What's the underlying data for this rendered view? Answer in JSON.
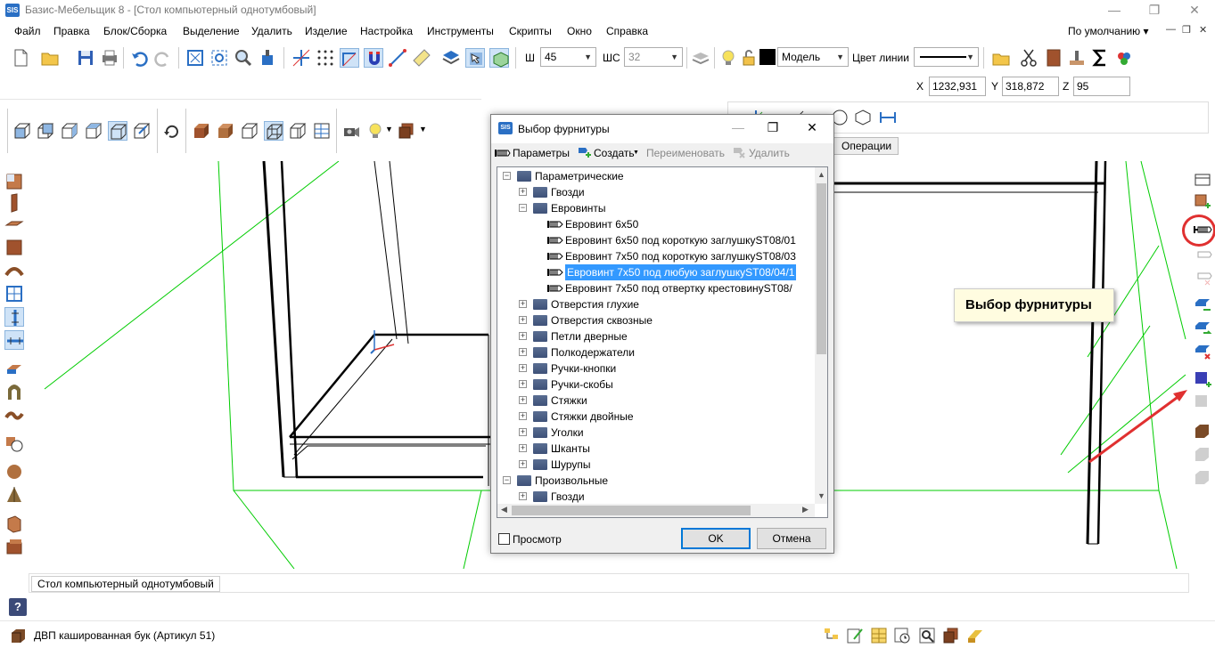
{
  "app": {
    "title": "Базис-Мебельщик 8 - [Стол компьютерный однотумбовый]",
    "icon_text": "SIS",
    "window_controls": {
      "minimize": "—",
      "restore": "❐",
      "close": "✕"
    }
  },
  "menu": {
    "items": [
      "Файл",
      "Правка",
      "Блок/Сборка",
      "Выделение",
      "Удалить",
      "Изделие",
      "Настройка",
      "Инструменты",
      "Скрипты",
      "Окно",
      "Справка"
    ],
    "profile": "По умолчанию ▾",
    "mdi_controls": {
      "minimize": "—",
      "restore": "❐",
      "close": "✕"
    }
  },
  "toolbar": {
    "width_label": "Ш",
    "width_value": "45",
    "step_label": "ШС",
    "step_value": "32",
    "layer_value": "Модель",
    "line_color_label": "Цвет линии"
  },
  "coords": {
    "x_label": "X",
    "x": "1232,931",
    "y_label": "Y",
    "y": "318,872",
    "z_label": "Z",
    "z": "95"
  },
  "operations_tab": "Операции",
  "dialog": {
    "title": "Выбор фурнитуры",
    "toolbar": {
      "params": "Параметры",
      "create": "Создать",
      "rename": "Переименовать",
      "delete": "Удалить"
    },
    "tree": [
      {
        "label": "Параметрические",
        "level": 0,
        "state": "open"
      },
      {
        "label": "Гвозди",
        "level": 1,
        "state": "closed"
      },
      {
        "label": "Евровинты",
        "level": 1,
        "state": "open"
      },
      {
        "label": "Евровинт 6х50",
        "level": 2,
        "state": "leaf"
      },
      {
        "label": "Евровинт 6х50 под короткую заглушкуST08/01",
        "level": 2,
        "state": "leaf"
      },
      {
        "label": "Евровинт 7х50 под короткую заглушкуST08/03",
        "level": 2,
        "state": "leaf"
      },
      {
        "label": "Евровинт 7х50 под любую заглушкуST08/04/1",
        "level": 2,
        "state": "leaf",
        "selected": true
      },
      {
        "label": "Евровинт 7х50 под отвертку крестовинуST08/",
        "level": 2,
        "state": "leaf"
      },
      {
        "label": "Отверстия глухие",
        "level": 1,
        "state": "closed"
      },
      {
        "label": "Отверстия сквозные",
        "level": 1,
        "state": "closed"
      },
      {
        "label": "Петли дверные",
        "level": 1,
        "state": "closed"
      },
      {
        "label": "Полкодержатели",
        "level": 1,
        "state": "closed"
      },
      {
        "label": "Ручки-кнопки",
        "level": 1,
        "state": "closed"
      },
      {
        "label": "Ручки-скобы",
        "level": 1,
        "state": "closed"
      },
      {
        "label": "Стяжки",
        "level": 1,
        "state": "closed"
      },
      {
        "label": "Стяжки двойные",
        "level": 1,
        "state": "closed"
      },
      {
        "label": "Уголки",
        "level": 1,
        "state": "closed"
      },
      {
        "label": "Шканты",
        "level": 1,
        "state": "closed"
      },
      {
        "label": "Шурупы",
        "level": 1,
        "state": "closed"
      },
      {
        "label": "Произвольные",
        "level": 0,
        "state": "open"
      },
      {
        "label": "Гвозди",
        "level": 1,
        "state": "closed"
      }
    ],
    "preview_label": "Просмотр",
    "ok": "OK",
    "cancel": "Отмена"
  },
  "callout": "Выбор фурнитуры",
  "status": {
    "document_tab": "Стол компьютерный однотумбовый",
    "help": "?"
  },
  "bottom": {
    "material": "ДВП кашированная бук (Артикул 51)"
  },
  "colors": {
    "accent": "#0078d7",
    "selection": "#3399ff",
    "guide_lines": "#00cc00",
    "callout_arrow": "#e03030"
  }
}
